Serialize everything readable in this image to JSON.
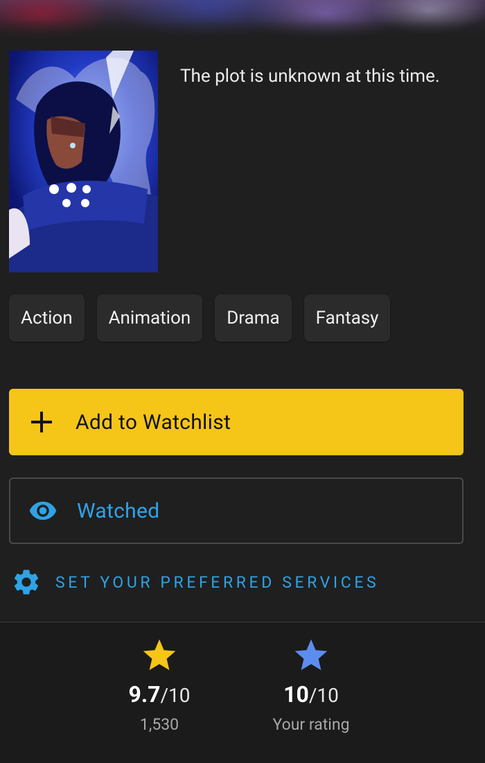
{
  "plot": "The plot is unknown at this time.",
  "genres": [
    "Action",
    "Animation",
    "Drama",
    "Fantasy"
  ],
  "actions": {
    "watchlist_label": "Add to Watchlist",
    "watched_label": "Watched",
    "services_label": "SET YOUR PREFERRED SERVICES"
  },
  "ratings": {
    "imdb": {
      "score": "9.7",
      "out_of": "/10",
      "count": "1,530"
    },
    "user": {
      "score": "10",
      "out_of": "/10",
      "label": "Your rating"
    }
  },
  "colors": {
    "accent_yellow": "#f5c518",
    "accent_blue": "#2fa3e6",
    "user_star": "#5b8def",
    "background": "#1f1f1f"
  },
  "icons": {
    "watchlist": "plus-icon",
    "watched": "eye-icon",
    "services": "gear-icon",
    "imdb_rating": "star-icon",
    "user_rating": "star-icon"
  }
}
